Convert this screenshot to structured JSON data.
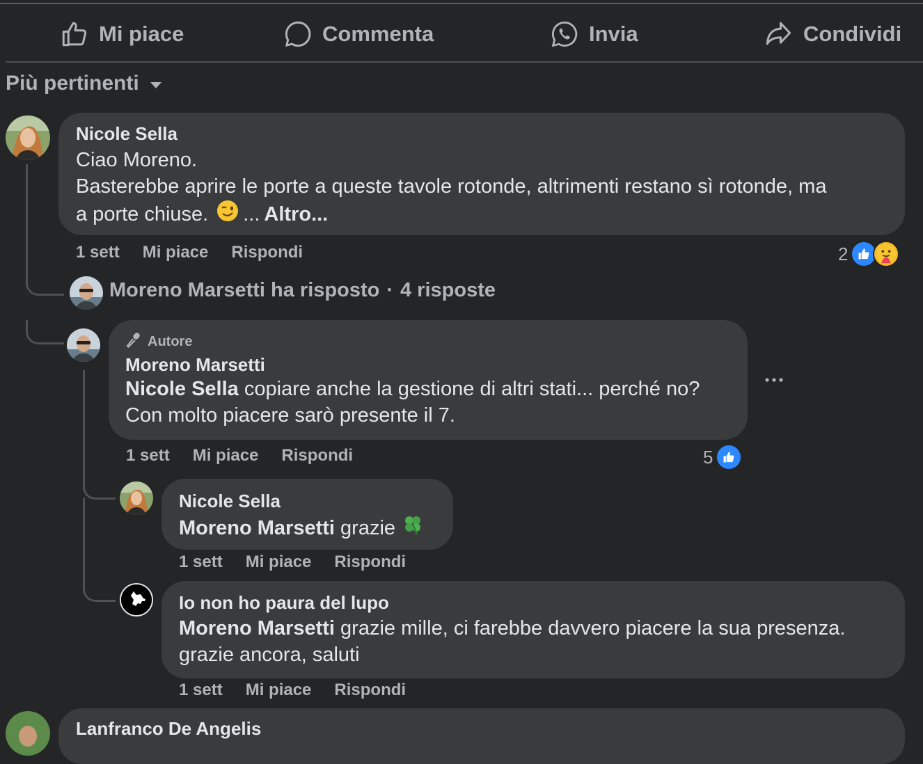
{
  "action_bar": {
    "like": "Mi piace",
    "comment": "Commenta",
    "send": "Invia",
    "share": "Condividi"
  },
  "sort": {
    "label": "Più pertinenti"
  },
  "comments": [
    {
      "author": "Nicole Sella",
      "line1": "Ciao Moreno.",
      "line2": "Basterebbe aprire le porte a queste tavole rotonde, altrimenti restano sì rotonde, ma",
      "line3": "a porte chiuse.",
      "ellipsis": "...",
      "more": "Altro...",
      "time": "1 sett",
      "like": "Mi piace",
      "reply": "Rispondi",
      "reaction_count": "2",
      "reaction_icons": [
        "like-icon",
        "care-icon"
      ]
    }
  ],
  "replies_summary": {
    "text": "Moreno Marsetti ha risposto",
    "separator": "·",
    "count": "4 risposte"
  },
  "replies": [
    {
      "badge": "Autore",
      "author": "Moreno Marsetti",
      "mention": "Nicole Sella",
      "text1": " copiare anche la gestione di altri stati... perché no?",
      "text2": "Con molto piacere sarò presente il 7.",
      "time": "1 sett",
      "like": "Mi piace",
      "reply": "Rispondi",
      "reaction_count": "5",
      "more_icon": "more-options-icon"
    },
    {
      "author": "Nicole Sella",
      "mention": "Moreno Marsetti",
      "text": " grazie",
      "emoji": "clover-icon",
      "time": "1 sett",
      "like": "Mi piace",
      "reply": "Rispondi"
    },
    {
      "author": "Io non ho paura del lupo",
      "mention": "Moreno Marsetti",
      "text1": " grazie mille, ci farebbe davvero piacere la sua presenza.",
      "text2": "grazie ancora, saluti",
      "time": "1 sett",
      "like": "Mi piace",
      "reply": "Rispondi",
      "avatar_lettering": [
        "io",
        "non ho",
        "paura",
        "del lupo"
      ]
    }
  ],
  "next_comment": {
    "author": "Lanfranco De Angelis"
  },
  "colors": {
    "background": "#242526",
    "bubble": "#3a3b3c",
    "text": "#e4e6eb",
    "secondary": "#b0b3b8",
    "like_blue": "#2d88ff"
  }
}
